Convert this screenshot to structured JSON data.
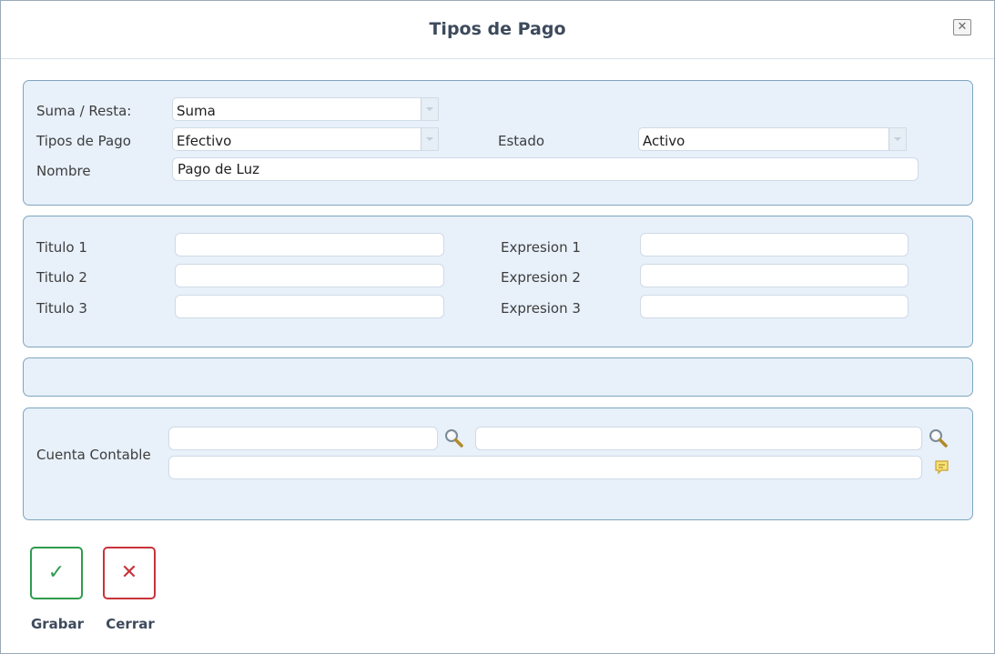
{
  "dialog": {
    "title": "Tipos de Pago",
    "close_symbol": "✕"
  },
  "general": {
    "suma_resta": {
      "label": "Suma / Resta:",
      "value": "Suma"
    },
    "tipos_pago": {
      "label": "Tipos de Pago",
      "value": "Efectivo"
    },
    "estado": {
      "label": "Estado",
      "value": "Activo"
    },
    "nombre": {
      "label": "Nombre",
      "value": "Pago de Luz"
    }
  },
  "titulos": [
    {
      "label": "Titulo 1",
      "value": ""
    },
    {
      "label": "Titulo 2",
      "value": ""
    },
    {
      "label": "Titulo 3",
      "value": ""
    }
  ],
  "expresiones": [
    {
      "label": "Expresion 1",
      "value": ""
    },
    {
      "label": "Expresion 2",
      "value": ""
    },
    {
      "label": "Expresion 3",
      "value": ""
    }
  ],
  "cuenta": {
    "label": "Cuenta Contable",
    "code_value": "",
    "name_value": "",
    "description_value": "",
    "icons": [
      "search-icon",
      "search-icon",
      "note-icon"
    ]
  },
  "actions": {
    "save": {
      "label": "Grabar",
      "icon": "checkmark-icon",
      "symbol": "✓",
      "color": "#2f9b4e"
    },
    "close": {
      "label": "Cerrar",
      "icon": "close-icon",
      "symbol": "✕",
      "color": "#c8333a"
    }
  },
  "colors": {
    "panel_bg": "#e8f0fa",
    "panel_border": "#7ea6bd",
    "title": "#3d4a5c"
  }
}
